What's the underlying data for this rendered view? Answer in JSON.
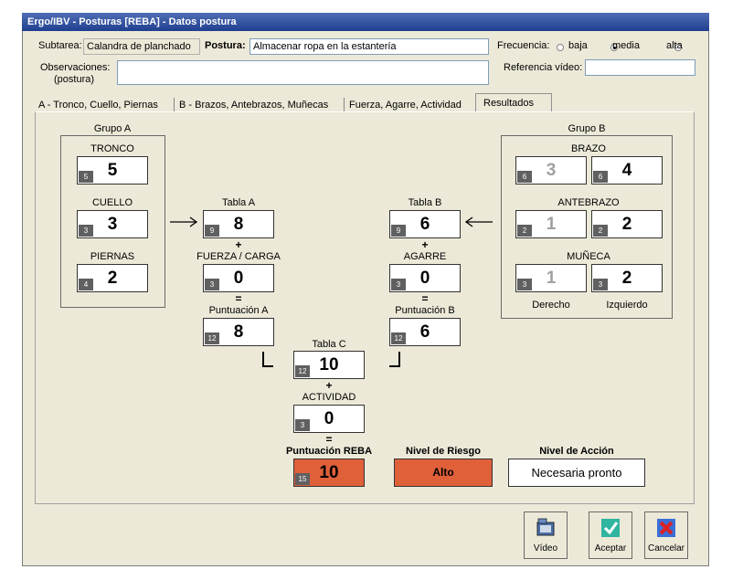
{
  "window": {
    "title": "Ergo/IBV - Posturas [REBA] - Datos postura"
  },
  "header": {
    "subtarea_label": "Subtarea:",
    "subtarea_value": "Calandra de planchado",
    "postura_label": "Postura:",
    "postura_value": "Almacenar ropa en la estantería",
    "frecuencia_label": "Frecuencia:",
    "frecuencia_options": [
      "baja",
      "media",
      "alta"
    ],
    "frecuencia_selected": "media",
    "observaciones_label": "Observaciones:",
    "observaciones_sub": "(postura)",
    "observaciones_value": "",
    "referencia_label": "Referencia vídeo:",
    "referencia_value": ""
  },
  "tabs": [
    {
      "label": "A - Tronco, Cuello, Piernas"
    },
    {
      "label": "B - Brazos, Antebrazos, Muñecas"
    },
    {
      "label": "Fuerza, Agarre, Actividad"
    },
    {
      "label": "Resultados"
    }
  ],
  "active_tab": "Resultados",
  "grupo_a": {
    "title": "Grupo A",
    "tronco": {
      "label": "TRONCO",
      "tag": "5",
      "value": "5"
    },
    "cuello": {
      "label": "CUELLO",
      "tag": "3",
      "value": "3"
    },
    "piernas": {
      "label": "PIERNAS",
      "tag": "4",
      "value": "2"
    }
  },
  "grupo_b": {
    "title": "Grupo B",
    "brazo": {
      "label": "BRAZO",
      "left_tag": "6",
      "left_value": "3",
      "right_tag": "6",
      "right_value": "4"
    },
    "antebrazo": {
      "label": "ANTEBRAZO",
      "left_tag": "2",
      "left_value": "1",
      "right_tag": "2",
      "right_value": "2"
    },
    "muneca": {
      "label": "MUÑECA",
      "left_tag": "3",
      "left_value": "1",
      "right_tag": "3",
      "right_value": "2"
    },
    "derecho_label": "Derecho",
    "izquierdo_label": "Izquierdo"
  },
  "col_a": {
    "tabla_label": "Tabla A",
    "tabla_tag": "9",
    "tabla_value": "8",
    "plus": "+",
    "fuerza_label": "FUERZA / CARGA",
    "fuerza_tag": "3",
    "fuerza_value": "0",
    "eq": "=",
    "puntuacion_label": "Puntuación A",
    "puntuacion_tag": "12",
    "puntuacion_value": "8"
  },
  "col_b": {
    "tabla_label": "Tabla B",
    "tabla_tag": "9",
    "tabla_value": "6",
    "plus": "+",
    "agarre_label": "AGARRE",
    "agarre_tag": "3",
    "agarre_value": "0",
    "eq": "=",
    "puntuacion_label": "Puntuación B",
    "puntuacion_tag": "12",
    "puntuacion_value": "6"
  },
  "col_c": {
    "tabla_label": "Tabla C",
    "tabla_tag": "12",
    "tabla_value": "10",
    "plus": "+",
    "actividad_label": "ACTIVIDAD",
    "actividad_tag": "3",
    "actividad_value": "0",
    "eq": "=",
    "reba_label": "Puntuación REBA",
    "reba_tag": "15",
    "reba_value": "10"
  },
  "riesgo": {
    "label": "Nivel de Riesgo",
    "value": "Alto"
  },
  "accion": {
    "label": "Nivel de Acción",
    "value": "Necesaria pronto"
  },
  "buttons": {
    "video": "Vídeo",
    "aceptar": "Aceptar",
    "cancelar": "Cancelar"
  },
  "colors": {
    "risk_fill": "#e0603a",
    "titlebar": "#2b4e9e",
    "tag": "#606060"
  }
}
